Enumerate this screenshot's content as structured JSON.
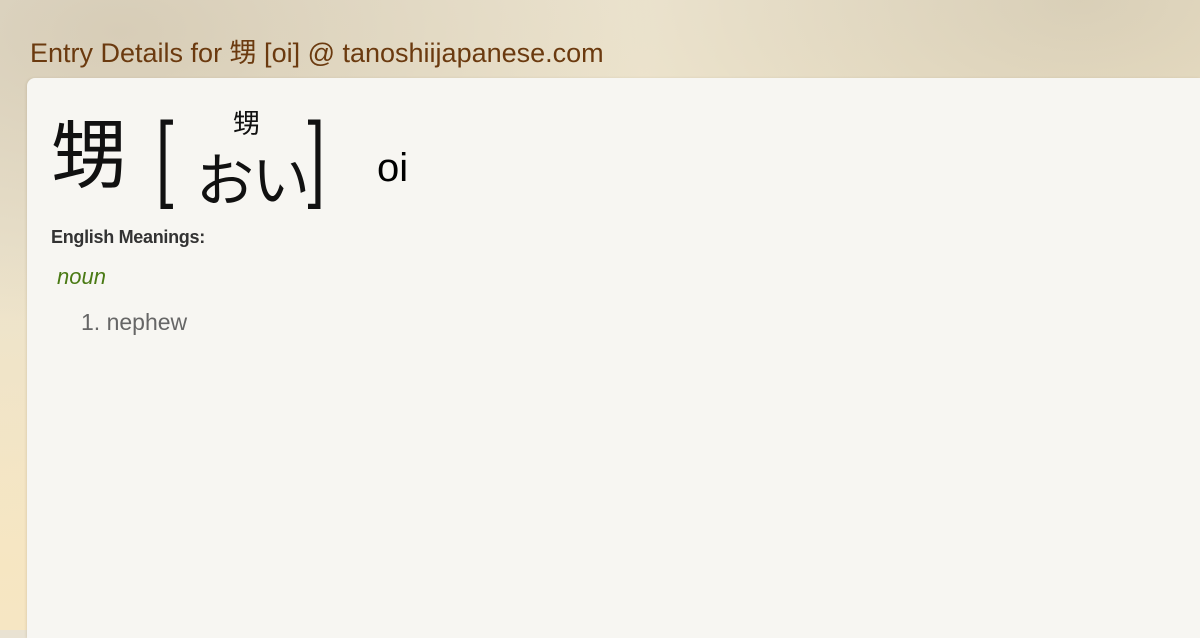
{
  "page": {
    "title": "Entry Details for 甥 [oi] @ tanoshiijapanese.com"
  },
  "entry": {
    "kanji": "甥",
    "bracket_open": "[",
    "bracket_close": "]",
    "furigana": "甥",
    "kana": "おい",
    "romaji": "oi",
    "meanings_label": "English Meanings:",
    "part_of_speech": "noun",
    "meanings": [
      "1. nephew"
    ]
  },
  "colors": {
    "title": "#6b3a0f",
    "pos": "#4a7a14",
    "meaning": "#666666",
    "panel": "#f7f6f2"
  }
}
